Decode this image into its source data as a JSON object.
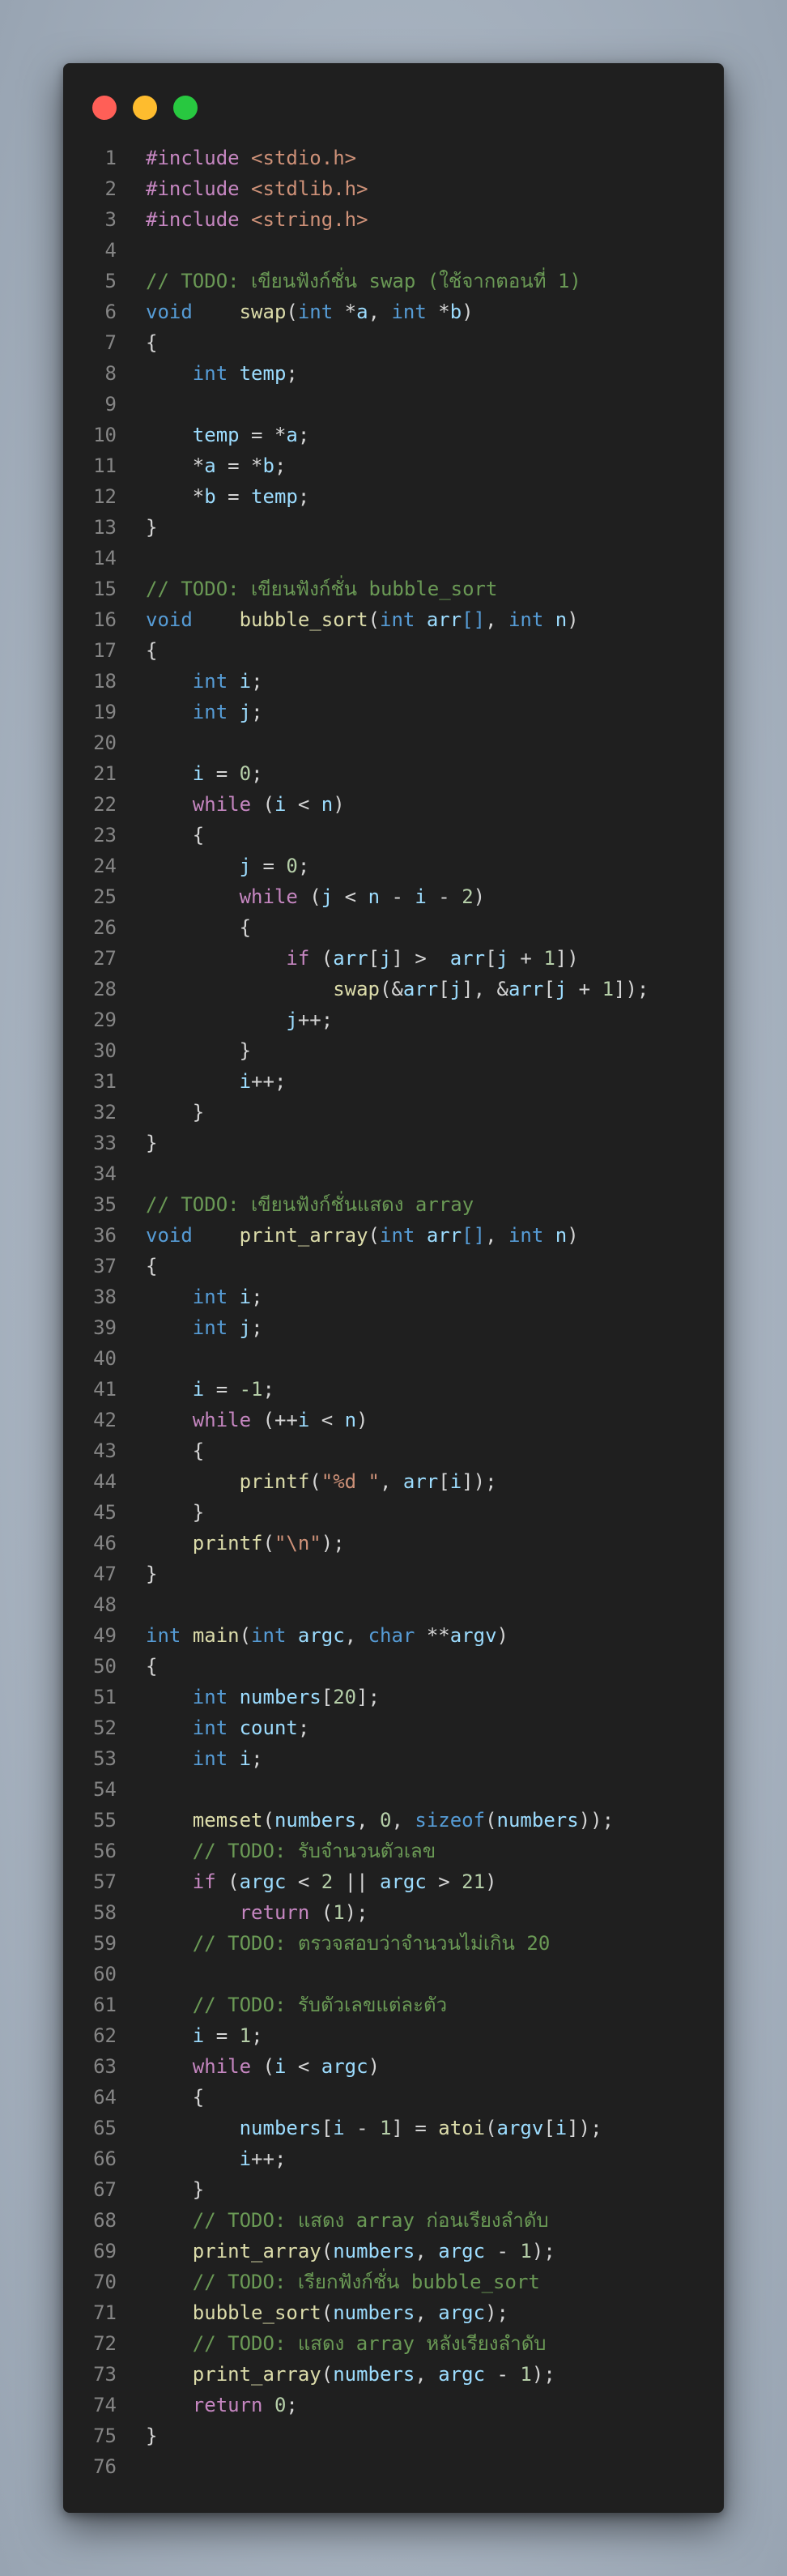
{
  "window": {
    "controls": {
      "close_color": "#ff5f57",
      "minimize_color": "#febc2e",
      "maximize_color": "#28c840"
    }
  },
  "theme": {
    "background": "#1f1f1f",
    "keyword": "#569cd6",
    "control": "#c586c0",
    "function": "#dcdcaa",
    "variable": "#9cdcfe",
    "number": "#b5cea8",
    "string": "#ce9178",
    "comment": "#6a9955",
    "line_number": "#858585"
  },
  "code_lines": [
    [
      [
        "pp",
        "#include "
      ],
      [
        "str",
        "<stdio.h>"
      ]
    ],
    [
      [
        "pp",
        "#include "
      ],
      [
        "str",
        "<stdlib.h>"
      ]
    ],
    [
      [
        "pp",
        "#include "
      ],
      [
        "str",
        "<string.h>"
      ]
    ],
    [],
    [
      [
        "cmt",
        "// TODO: เขียนฟังก์ชั่น swap (ใช้จากตอนที่ 1)"
      ]
    ],
    [
      [
        "kw",
        "void"
      ],
      [
        "txt",
        "    "
      ],
      [
        "fn",
        "swap"
      ],
      [
        "txt",
        "("
      ],
      [
        "kw",
        "int"
      ],
      [
        "txt",
        " *"
      ],
      [
        "var",
        "a"
      ],
      [
        "txt",
        ", "
      ],
      [
        "kw",
        "int"
      ],
      [
        "txt",
        " *"
      ],
      [
        "var",
        "b"
      ],
      [
        "txt",
        ")"
      ]
    ],
    [
      [
        "txt",
        "{"
      ]
    ],
    [
      [
        "txt",
        "    "
      ],
      [
        "kw",
        "int"
      ],
      [
        "txt",
        " "
      ],
      [
        "var",
        "temp"
      ],
      [
        "txt",
        ";"
      ]
    ],
    [],
    [
      [
        "txt",
        "    "
      ],
      [
        "var",
        "temp"
      ],
      [
        "txt",
        " = *"
      ],
      [
        "var",
        "a"
      ],
      [
        "txt",
        ";"
      ]
    ],
    [
      [
        "txt",
        "    *"
      ],
      [
        "var",
        "a"
      ],
      [
        "txt",
        " = *"
      ],
      [
        "var",
        "b"
      ],
      [
        "txt",
        ";"
      ]
    ],
    [
      [
        "txt",
        "    *"
      ],
      [
        "var",
        "b"
      ],
      [
        "txt",
        " = "
      ],
      [
        "var",
        "temp"
      ],
      [
        "txt",
        ";"
      ]
    ],
    [
      [
        "txt",
        "}"
      ]
    ],
    [],
    [
      [
        "cmt",
        "// TODO: เขียนฟังก์ชั่น bubble_sort"
      ]
    ],
    [
      [
        "kw",
        "void"
      ],
      [
        "txt",
        "    "
      ],
      [
        "fn",
        "bubble_sort"
      ],
      [
        "txt",
        "("
      ],
      [
        "kw",
        "int"
      ],
      [
        "txt",
        " "
      ],
      [
        "var",
        "arr"
      ],
      [
        "kw",
        "[]"
      ],
      [
        "txt",
        ", "
      ],
      [
        "kw",
        "int"
      ],
      [
        "txt",
        " "
      ],
      [
        "var",
        "n"
      ],
      [
        "txt",
        ")"
      ]
    ],
    [
      [
        "txt",
        "{"
      ]
    ],
    [
      [
        "txt",
        "    "
      ],
      [
        "kw",
        "int"
      ],
      [
        "txt",
        " "
      ],
      [
        "var",
        "i"
      ],
      [
        "txt",
        ";"
      ]
    ],
    [
      [
        "txt",
        "    "
      ],
      [
        "kw",
        "int"
      ],
      [
        "txt",
        " "
      ],
      [
        "var",
        "j"
      ],
      [
        "txt",
        ";"
      ]
    ],
    [],
    [
      [
        "txt",
        "    "
      ],
      [
        "var",
        "i"
      ],
      [
        "txt",
        " = "
      ],
      [
        "num",
        "0"
      ],
      [
        "txt",
        ";"
      ]
    ],
    [
      [
        "txt",
        "    "
      ],
      [
        "ctl",
        "while"
      ],
      [
        "txt",
        " ("
      ],
      [
        "var",
        "i"
      ],
      [
        "txt",
        " < "
      ],
      [
        "var",
        "n"
      ],
      [
        "txt",
        ")"
      ]
    ],
    [
      [
        "txt",
        "    {"
      ]
    ],
    [
      [
        "txt",
        "        "
      ],
      [
        "var",
        "j"
      ],
      [
        "txt",
        " = "
      ],
      [
        "num",
        "0"
      ],
      [
        "txt",
        ";"
      ]
    ],
    [
      [
        "txt",
        "        "
      ],
      [
        "ctl",
        "while"
      ],
      [
        "txt",
        " ("
      ],
      [
        "var",
        "j"
      ],
      [
        "txt",
        " < "
      ],
      [
        "var",
        "n"
      ],
      [
        "txt",
        " - "
      ],
      [
        "var",
        "i"
      ],
      [
        "txt",
        " - "
      ],
      [
        "num",
        "2"
      ],
      [
        "txt",
        ")"
      ]
    ],
    [
      [
        "txt",
        "        {"
      ]
    ],
    [
      [
        "txt",
        "            "
      ],
      [
        "ctl",
        "if"
      ],
      [
        "txt",
        " ("
      ],
      [
        "var",
        "arr"
      ],
      [
        "txt",
        "["
      ],
      [
        "var",
        "j"
      ],
      [
        "txt",
        "] >  "
      ],
      [
        "var",
        "arr"
      ],
      [
        "txt",
        "["
      ],
      [
        "var",
        "j"
      ],
      [
        "txt",
        " + "
      ],
      [
        "num",
        "1"
      ],
      [
        "txt",
        "])"
      ]
    ],
    [
      [
        "txt",
        "                "
      ],
      [
        "fn",
        "swap"
      ],
      [
        "txt",
        "(&"
      ],
      [
        "var",
        "arr"
      ],
      [
        "txt",
        "["
      ],
      [
        "var",
        "j"
      ],
      [
        "txt",
        "], &"
      ],
      [
        "var",
        "arr"
      ],
      [
        "txt",
        "["
      ],
      [
        "var",
        "j"
      ],
      [
        "txt",
        " + "
      ],
      [
        "num",
        "1"
      ],
      [
        "txt",
        "]);"
      ]
    ],
    [
      [
        "txt",
        "            "
      ],
      [
        "var",
        "j"
      ],
      [
        "txt",
        "++;"
      ]
    ],
    [
      [
        "txt",
        "        }"
      ]
    ],
    [
      [
        "txt",
        "        "
      ],
      [
        "var",
        "i"
      ],
      [
        "txt",
        "++;"
      ]
    ],
    [
      [
        "txt",
        "    }"
      ]
    ],
    [
      [
        "txt",
        "}"
      ]
    ],
    [],
    [
      [
        "cmt",
        "// TODO: เขียนฟังก์ชั่นแสดง array"
      ]
    ],
    [
      [
        "kw",
        "void"
      ],
      [
        "txt",
        "    "
      ],
      [
        "fn",
        "print_array"
      ],
      [
        "txt",
        "("
      ],
      [
        "kw",
        "int"
      ],
      [
        "txt",
        " "
      ],
      [
        "var",
        "arr"
      ],
      [
        "kw",
        "[]"
      ],
      [
        "txt",
        ", "
      ],
      [
        "kw",
        "int"
      ],
      [
        "txt",
        " "
      ],
      [
        "var",
        "n"
      ],
      [
        "txt",
        ")"
      ]
    ],
    [
      [
        "txt",
        "{"
      ]
    ],
    [
      [
        "txt",
        "    "
      ],
      [
        "kw",
        "int"
      ],
      [
        "txt",
        " "
      ],
      [
        "var",
        "i"
      ],
      [
        "txt",
        ";"
      ]
    ],
    [
      [
        "txt",
        "    "
      ],
      [
        "kw",
        "int"
      ],
      [
        "txt",
        " "
      ],
      [
        "var",
        "j"
      ],
      [
        "txt",
        ";"
      ]
    ],
    [],
    [
      [
        "txt",
        "    "
      ],
      [
        "var",
        "i"
      ],
      [
        "txt",
        " = "
      ],
      [
        "num",
        "-1"
      ],
      [
        "txt",
        ";"
      ]
    ],
    [
      [
        "txt",
        "    "
      ],
      [
        "ctl",
        "while"
      ],
      [
        "txt",
        " (++"
      ],
      [
        "var",
        "i"
      ],
      [
        "txt",
        " < "
      ],
      [
        "var",
        "n"
      ],
      [
        "txt",
        ")"
      ]
    ],
    [
      [
        "txt",
        "    {"
      ]
    ],
    [
      [
        "txt",
        "        "
      ],
      [
        "fn",
        "printf"
      ],
      [
        "txt",
        "("
      ],
      [
        "str",
        "\"%d \""
      ],
      [
        "txt",
        ", "
      ],
      [
        "var",
        "arr"
      ],
      [
        "txt",
        "["
      ],
      [
        "var",
        "i"
      ],
      [
        "txt",
        "]);"
      ]
    ],
    [
      [
        "txt",
        "    }"
      ]
    ],
    [
      [
        "txt",
        "    "
      ],
      [
        "fn",
        "printf"
      ],
      [
        "txt",
        "("
      ],
      [
        "str",
        "\"\\n\""
      ],
      [
        "txt",
        ");"
      ]
    ],
    [
      [
        "txt",
        "}"
      ]
    ],
    [],
    [
      [
        "kw",
        "int"
      ],
      [
        "txt",
        " "
      ],
      [
        "fn",
        "main"
      ],
      [
        "txt",
        "("
      ],
      [
        "kw",
        "int"
      ],
      [
        "txt",
        " "
      ],
      [
        "var",
        "argc"
      ],
      [
        "txt",
        ", "
      ],
      [
        "kw",
        "char"
      ],
      [
        "txt",
        " **"
      ],
      [
        "var",
        "argv"
      ],
      [
        "txt",
        ")"
      ]
    ],
    [
      [
        "txt",
        "{"
      ]
    ],
    [
      [
        "txt",
        "    "
      ],
      [
        "kw",
        "int"
      ],
      [
        "txt",
        " "
      ],
      [
        "var",
        "numbers"
      ],
      [
        "txt",
        "["
      ],
      [
        "num",
        "20"
      ],
      [
        "txt",
        "];"
      ]
    ],
    [
      [
        "txt",
        "    "
      ],
      [
        "kw",
        "int"
      ],
      [
        "txt",
        " "
      ],
      [
        "var",
        "count"
      ],
      [
        "txt",
        ";"
      ]
    ],
    [
      [
        "txt",
        "    "
      ],
      [
        "kw",
        "int"
      ],
      [
        "txt",
        " "
      ],
      [
        "var",
        "i"
      ],
      [
        "txt",
        ";"
      ]
    ],
    [],
    [
      [
        "txt",
        "    "
      ],
      [
        "fn",
        "memset"
      ],
      [
        "txt",
        "("
      ],
      [
        "var",
        "numbers"
      ],
      [
        "txt",
        ", "
      ],
      [
        "num",
        "0"
      ],
      [
        "txt",
        ", "
      ],
      [
        "kw",
        "sizeof"
      ],
      [
        "txt",
        "("
      ],
      [
        "var",
        "numbers"
      ],
      [
        "txt",
        "));"
      ]
    ],
    [
      [
        "txt",
        "    "
      ],
      [
        "cmt",
        "// TODO: รับจำนวนตัวเลข"
      ]
    ],
    [
      [
        "txt",
        "    "
      ],
      [
        "ctl",
        "if"
      ],
      [
        "txt",
        " ("
      ],
      [
        "var",
        "argc"
      ],
      [
        "txt",
        " < "
      ],
      [
        "num",
        "2"
      ],
      [
        "txt",
        " || "
      ],
      [
        "var",
        "argc"
      ],
      [
        "txt",
        " > "
      ],
      [
        "num",
        "21"
      ],
      [
        "txt",
        ")"
      ]
    ],
    [
      [
        "txt",
        "        "
      ],
      [
        "ctl",
        "return"
      ],
      [
        "txt",
        " ("
      ],
      [
        "num",
        "1"
      ],
      [
        "txt",
        ");"
      ]
    ],
    [
      [
        "txt",
        "    "
      ],
      [
        "cmt",
        "// TODO: ตรวจสอบว่าจำนวนไม่เกิน 20"
      ]
    ],
    [],
    [
      [
        "txt",
        "    "
      ],
      [
        "cmt",
        "// TODO: รับตัวเลขแต่ละตัว"
      ]
    ],
    [
      [
        "txt",
        "    "
      ],
      [
        "var",
        "i"
      ],
      [
        "txt",
        " = "
      ],
      [
        "num",
        "1"
      ],
      [
        "txt",
        ";"
      ]
    ],
    [
      [
        "txt",
        "    "
      ],
      [
        "ctl",
        "while"
      ],
      [
        "txt",
        " ("
      ],
      [
        "var",
        "i"
      ],
      [
        "txt",
        " < "
      ],
      [
        "var",
        "argc"
      ],
      [
        "txt",
        ")"
      ]
    ],
    [
      [
        "txt",
        "    {"
      ]
    ],
    [
      [
        "txt",
        "        "
      ],
      [
        "var",
        "numbers"
      ],
      [
        "txt",
        "["
      ],
      [
        "var",
        "i"
      ],
      [
        "txt",
        " - "
      ],
      [
        "num",
        "1"
      ],
      [
        "txt",
        "] = "
      ],
      [
        "fn",
        "atoi"
      ],
      [
        "txt",
        "("
      ],
      [
        "var",
        "argv"
      ],
      [
        "txt",
        "["
      ],
      [
        "var",
        "i"
      ],
      [
        "txt",
        "]);"
      ]
    ],
    [
      [
        "txt",
        "        "
      ],
      [
        "var",
        "i"
      ],
      [
        "txt",
        "++;"
      ]
    ],
    [
      [
        "txt",
        "    }"
      ]
    ],
    [
      [
        "txt",
        "    "
      ],
      [
        "cmt",
        "// TODO: แสดง array ก่อนเรียงลำดับ"
      ]
    ],
    [
      [
        "txt",
        "    "
      ],
      [
        "fn",
        "print_array"
      ],
      [
        "txt",
        "("
      ],
      [
        "var",
        "numbers"
      ],
      [
        "txt",
        ", "
      ],
      [
        "var",
        "argc"
      ],
      [
        "txt",
        " - "
      ],
      [
        "num",
        "1"
      ],
      [
        "txt",
        ");"
      ]
    ],
    [
      [
        "txt",
        "    "
      ],
      [
        "cmt",
        "// TODO: เรียกฟังก์ชั่น bubble_sort"
      ]
    ],
    [
      [
        "txt",
        "    "
      ],
      [
        "fn",
        "bubble_sort"
      ],
      [
        "txt",
        "("
      ],
      [
        "var",
        "numbers"
      ],
      [
        "txt",
        ", "
      ],
      [
        "var",
        "argc"
      ],
      [
        "txt",
        ");"
      ]
    ],
    [
      [
        "txt",
        "    "
      ],
      [
        "cmt",
        "// TODO: แสดง array หลังเรียงลำดับ"
      ]
    ],
    [
      [
        "txt",
        "    "
      ],
      [
        "fn",
        "print_array"
      ],
      [
        "txt",
        "("
      ],
      [
        "var",
        "numbers"
      ],
      [
        "txt",
        ", "
      ],
      [
        "var",
        "argc"
      ],
      [
        "txt",
        " - "
      ],
      [
        "num",
        "1"
      ],
      [
        "txt",
        ");"
      ]
    ],
    [
      [
        "txt",
        "    "
      ],
      [
        "ctl",
        "return"
      ],
      [
        "txt",
        " "
      ],
      [
        "num",
        "0"
      ],
      [
        "txt",
        ";"
      ]
    ],
    [
      [
        "txt",
        "}"
      ]
    ],
    []
  ]
}
